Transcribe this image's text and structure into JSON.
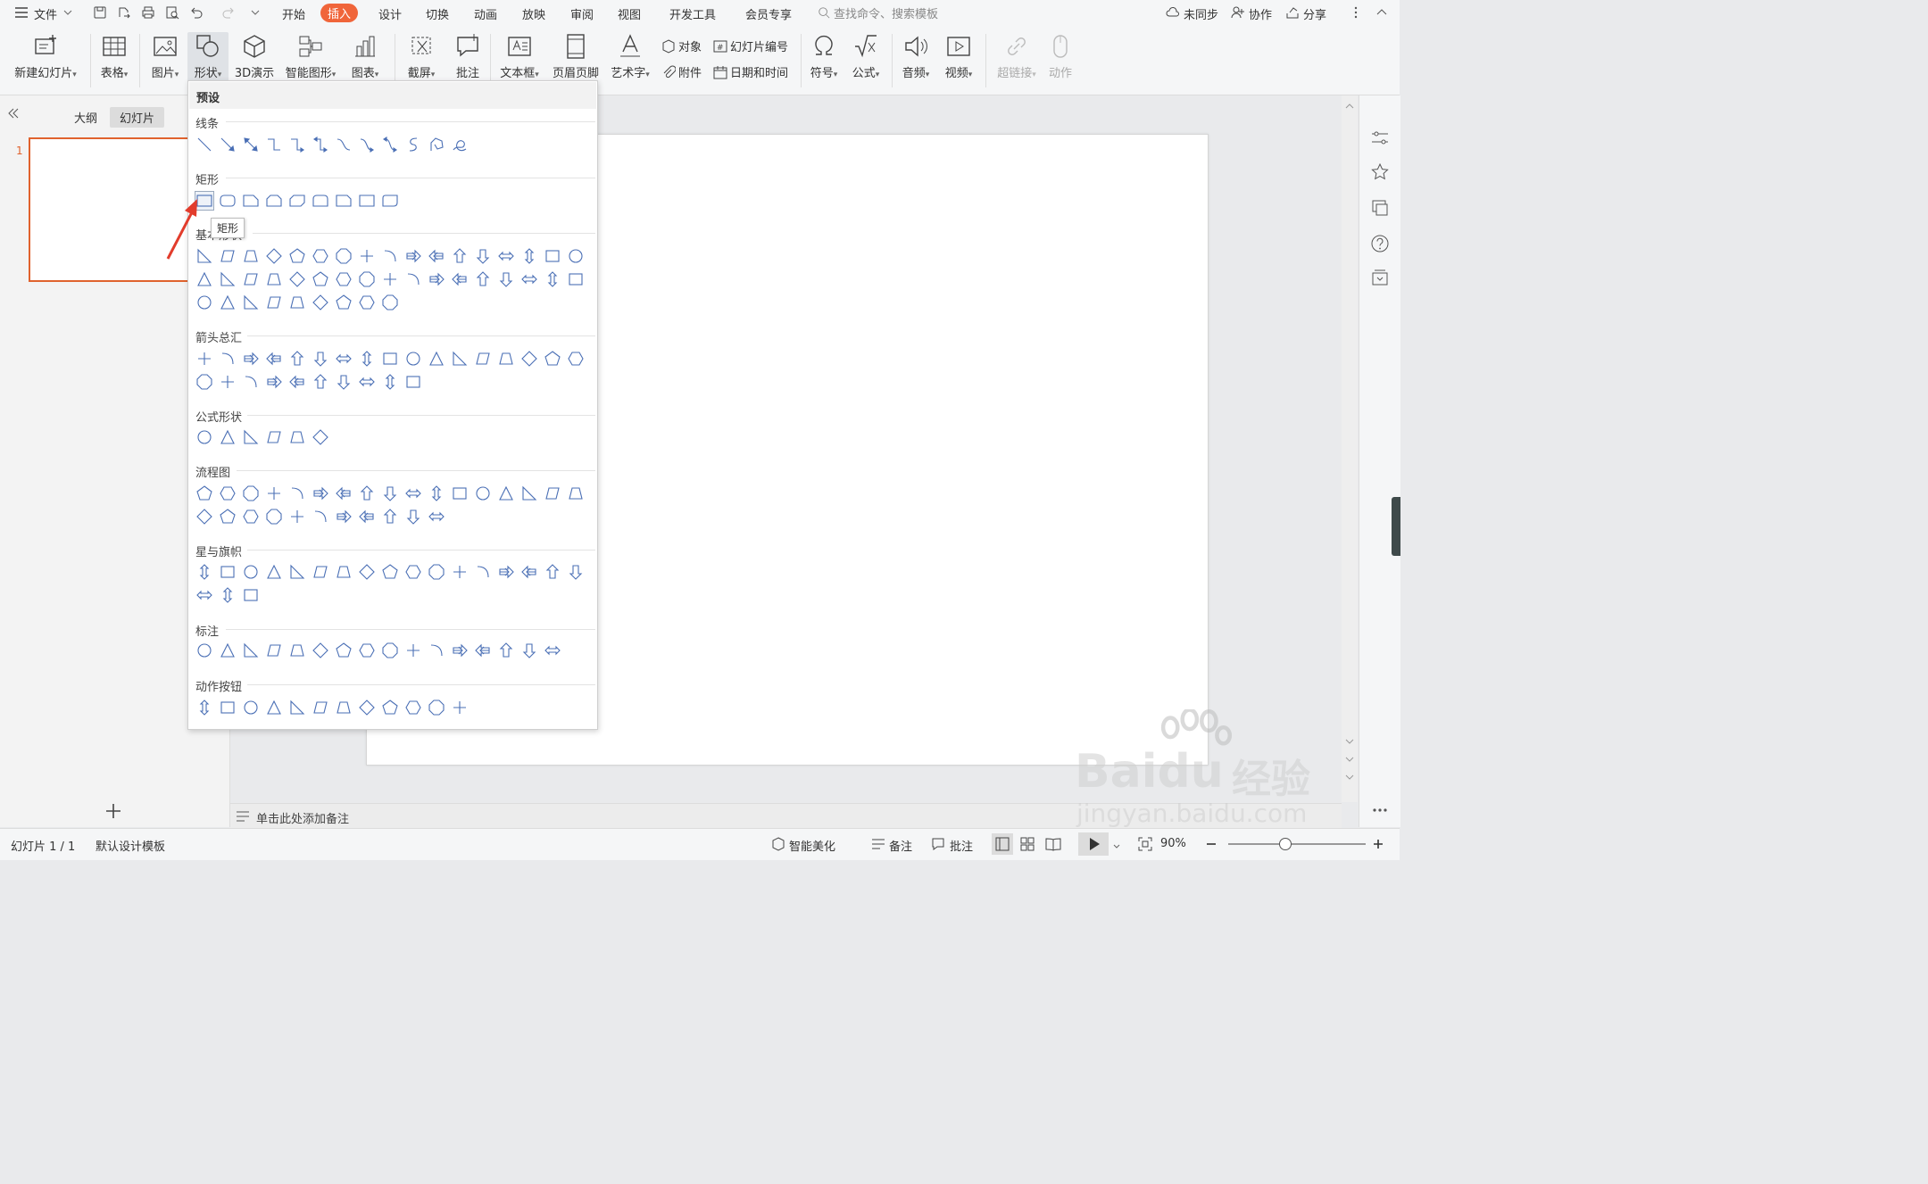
{
  "menubar": {
    "file_label": "文件",
    "tabs": [
      "开始",
      "插入",
      "设计",
      "切换",
      "动画",
      "放映",
      "审阅",
      "视图",
      "开发工具",
      "会员专享"
    ],
    "active_tab": "插入",
    "search_placeholder": "查找命令、搜索模板",
    "sync_label": "未同步",
    "collab_label": "协作",
    "share_label": "分享"
  },
  "ribbon": {
    "new_slide": "新建幻灯片",
    "table": "表格",
    "picture": "图片",
    "shape": "形状",
    "threed": "3D演示",
    "smart_graphic": "智能图形",
    "chart": "图表",
    "screenshot": "截屏",
    "comment": "批注",
    "textbox": "文本框",
    "header_footer": "页眉页脚",
    "wordart": "艺术字",
    "object": "对象",
    "slide_number": "幻灯片编号",
    "attachment": "附件",
    "date_time": "日期和时间",
    "symbol": "符号",
    "formula": "公式",
    "audio": "音频",
    "video": "视频",
    "hyperlink": "超链接",
    "action": "动作"
  },
  "leftpane": {
    "tab_outline": "大纲",
    "tab_slides": "幻灯片",
    "slide_number": "1",
    "add_icon": "plus-icon"
  },
  "shape_menu": {
    "preset_title": "预设",
    "categories": {
      "lines": "线条",
      "rectangles": "矩形",
      "basic": "基本形状",
      "arrows": "箭头总汇",
      "equation": "公式形状",
      "flowchart": "流程图",
      "stars": "星与旗帜",
      "callouts": "标注",
      "action_buttons": "动作按钮"
    },
    "tooltip": "矩形",
    "selected_shape": "rectangle"
  },
  "notes": {
    "placeholder": "单击此处添加备注"
  },
  "statusbar": {
    "slide_info": "幻灯片 1 / 1",
    "template": "默认设计模板",
    "smart_beautify": "智能美化",
    "notes": "备注",
    "comments": "批注",
    "zoom": "90%"
  },
  "watermark": {
    "brand": "Baidu",
    "brand_cn": "经验",
    "url": "jingyan.baidu.com"
  },
  "colors": {
    "accent": "#f0653a",
    "shape_stroke": "#4a6fb5",
    "selection_border": "#e0622d",
    "annotation_arrow": "#e23c2c"
  }
}
